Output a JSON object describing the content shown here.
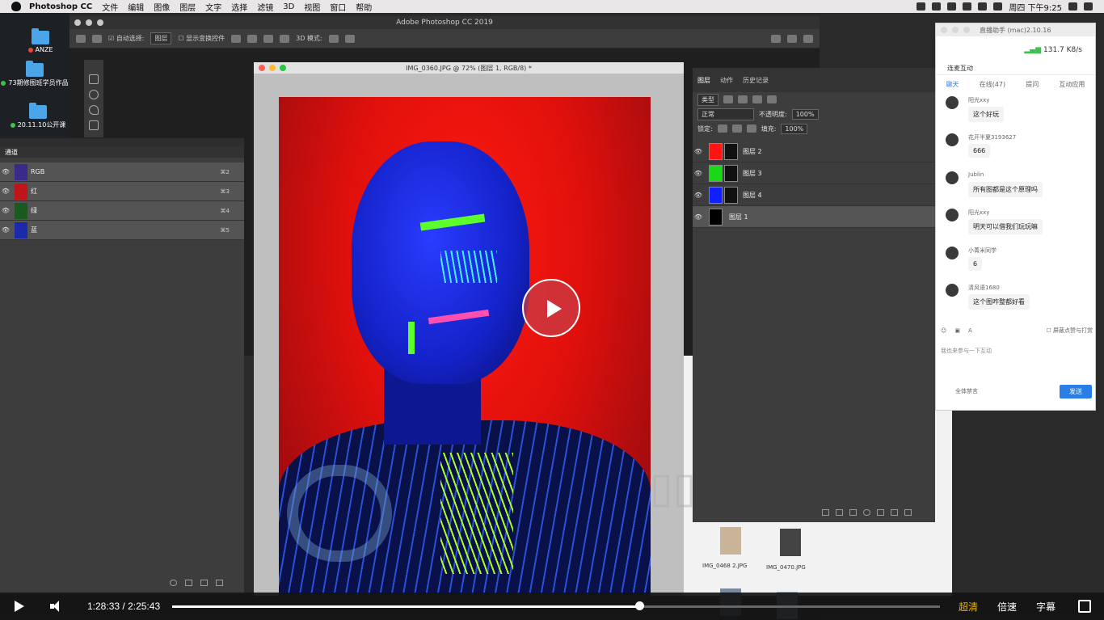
{
  "menubar": {
    "app": "Photoshop CC",
    "items": [
      "文件",
      "编辑",
      "图像",
      "图层",
      "文字",
      "选择",
      "滤镜",
      "3D",
      "视图",
      "窗口",
      "帮助"
    ],
    "clock": "周四 下午9:25"
  },
  "desktop": {
    "icons": [
      {
        "label": "ANZE",
        "dot_color": "#e8453c"
      },
      {
        "label": "73期修图班学员作品",
        "dot_color": "#3cc24e"
      },
      {
        "label": "20.11.10公开课",
        "dot_color": "#3cc24e"
      }
    ]
  },
  "photoshop": {
    "window_title": "Adobe Photoshop CC 2019",
    "options": {
      "auto_select": "自动选择:",
      "auto_select_target": "图层",
      "show_transform": "显示变换控件",
      "mode3d": "3D 模式:"
    }
  },
  "channels": {
    "tab": "通道",
    "rows": [
      {
        "label": "RGB",
        "shortcut": "⌘2",
        "color": "#3a2a8a"
      },
      {
        "label": "红",
        "shortcut": "⌘3",
        "color": "#c0141a"
      },
      {
        "label": "绿",
        "shortcut": "⌘4",
        "color": "#1a5a20"
      },
      {
        "label": "蓝",
        "shortcut": "⌘5",
        "color": "#1a2aa8"
      }
    ]
  },
  "document": {
    "title": "IMG_0360.JPG @ 72% (图层 1, RGB/8) *"
  },
  "layers": {
    "tabs": [
      "图层",
      "动作",
      "历史记录"
    ],
    "filter": "类型",
    "blend": "正常",
    "opacity_label": "不透明度:",
    "opacity": "100%",
    "lock_label": "锁定:",
    "fill_label": "填充:",
    "fill": "100%",
    "items": [
      {
        "name": "图层 2",
        "color": "#ff1414"
      },
      {
        "name": "图层 3",
        "color": "#18d818"
      },
      {
        "name": "图层 4",
        "color": "#1020ff"
      },
      {
        "name": "图层 1",
        "color": "#000000"
      }
    ]
  },
  "browser": {
    "files": [
      "IMG_0468 2.JPG",
      "IMG_0470.JPG"
    ]
  },
  "live": {
    "title": "直播助手 (mac)2.10.16",
    "speed": "131.7 K8/s",
    "section": "连麦互动",
    "tabs": [
      "聊天",
      "在线(47)",
      "提问",
      "互动应用"
    ],
    "messages": [
      {
        "nick": "阳光xxy",
        "text": "这个好玩"
      },
      {
        "nick": "花开半夏3193627",
        "text": "666"
      },
      {
        "nick": "Jublin",
        "text": "所有图都是这个原理吗"
      },
      {
        "nick": "阳光xxy",
        "text": "明天可以借我们玩玩嘛"
      },
      {
        "nick": "小菁米同学",
        "text": "6"
      },
      {
        "nick": "清风语1680",
        "text": "这个图咋整都好看"
      }
    ],
    "block_label": "屏蔽点赞与打赏",
    "input_placeholder": "我也来参与一下互动",
    "mute_all": "全体禁言",
    "send": "发送"
  },
  "player": {
    "current": "1:28:33",
    "separator": "/",
    "total": "2:25:43",
    "progress": 0.608,
    "quality": "超清",
    "speed": "倍速",
    "subtitle": "字幕",
    "quality_color": "#f0b400"
  }
}
